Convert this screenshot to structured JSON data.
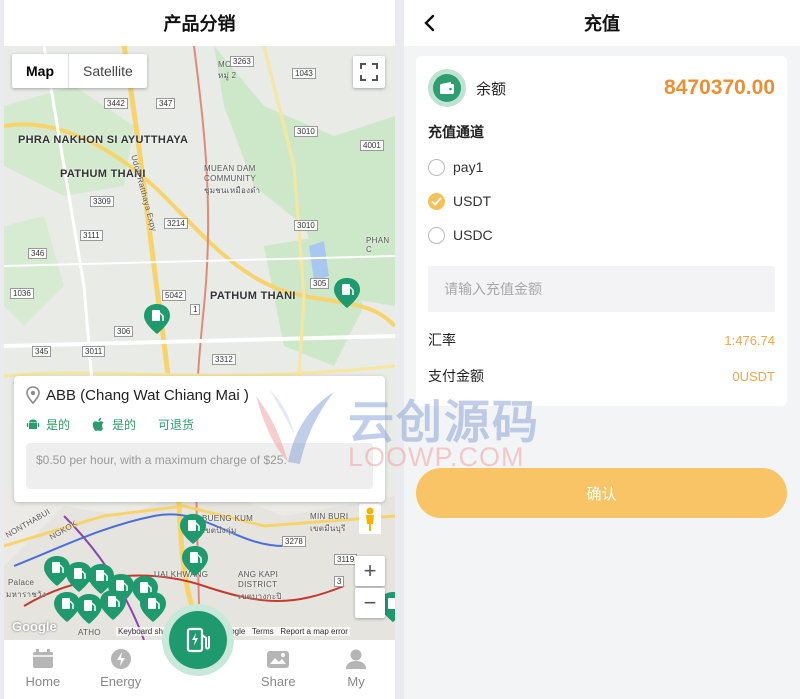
{
  "left": {
    "title": "产品分销",
    "map": {
      "type_controls": [
        "Map",
        "Satellite"
      ],
      "labels": {
        "phra": "PHRA NAKHON SI AYUTTHAYA",
        "pathum_thani_1": "PATHUM THANI",
        "muean_dam": "MUEAN DAM",
        "community": "COMMUNITY",
        "muean_thai": "ชุมชนเหมืองดำ",
        "pathum_thani_2": "PATHUM THANI",
        "phan": "PHAN C",
        "nonthaburi": "NONTHABUI",
        "bangkok": "NGKOK",
        "sueng_kum": "BUENG KUM",
        "sueng_kum_th": "เขตบึงกุ่ม",
        "min_buri": "MIN BURI",
        "min_buri_th": "เขตมีนบุรี",
        "huai_khwang": "UAI KHWANG",
        "kapi": "ANG KAPI",
        "district": "DISTRICT",
        "kapi_th": "เขตบางกะปิ",
        "palace": "Palace",
        "palace_th": "มหาราชวัง",
        "vibhavadi": "Udon Ratthaya Expy",
        "moo2": "MOO 2",
        "moo2_th": "หมู่ 2",
        "sathon": "ATHO"
      },
      "shields": [
        "3263",
        "1043",
        "3442",
        "347",
        "3010",
        "4001",
        "3309",
        "3214",
        "3010",
        "3111",
        "346",
        "1036",
        "305",
        "5042",
        "3312",
        "306",
        "3011",
        "345",
        "3278",
        "3119",
        "3",
        "1"
      ],
      "google": "Google",
      "attribution": [
        "Keyboard shortcuts",
        "©2024 Google",
        "Terms",
        "Report a map error"
      ],
      "zoom_in": "+",
      "zoom_out": "−"
    },
    "info_card": {
      "title": "ABB (Chang Wat Chiang Mai )",
      "tags": [
        "是的",
        "是的",
        "可退货"
      ],
      "description": "$0.50 per hour, with a maximum charge of $25."
    },
    "tabs": [
      "Home",
      "Energy",
      "Share",
      "My"
    ]
  },
  "right": {
    "title": "充值",
    "balance_label": "余额",
    "balance_value": "8470370.00",
    "channel_title": "充值通道",
    "options": [
      {
        "label": "pay1",
        "checked": false
      },
      {
        "label": "USDT",
        "checked": true
      },
      {
        "label": "USDC",
        "checked": false
      }
    ],
    "amount_placeholder": "请输入充值金额",
    "rate_label": "汇率",
    "rate_value": "1:476.74",
    "pay_label": "支付金额",
    "pay_value": "0USDT",
    "confirm": "确认"
  },
  "watermark": {
    "line1": "云创源码",
    "line2": "LOOWP.COM"
  },
  "colors": {
    "green": "#1f9a6e",
    "orange": "#eb8f33",
    "yellow": "#f8c466"
  }
}
